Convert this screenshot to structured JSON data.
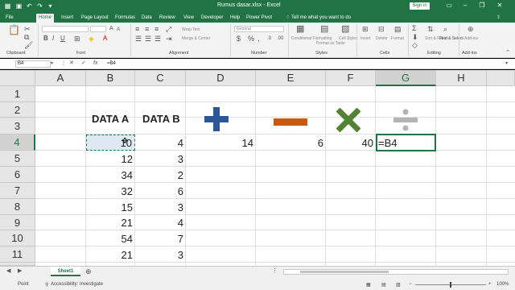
{
  "window": {
    "title": "Rumus dasar.xlsx  -  Excel",
    "signin": "Sign in"
  },
  "tabs": [
    "File",
    "Home",
    "Insert",
    "Page Layout",
    "Formulas",
    "Data",
    "Review",
    "View",
    "Developer",
    "Help",
    "Power Pivot"
  ],
  "tell_me": "Tell me what you want to do",
  "ribbon": {
    "groups": [
      "Clipboard",
      "Font",
      "Alignment",
      "Number",
      "Styles",
      "Cells",
      "Editing",
      "Add-ins"
    ],
    "wrap_text": "Wrap Text",
    "merge_center": "Merge & Center",
    "number_format": "General",
    "styles_buttons": [
      "Conditional Formatting",
      "Format as Table",
      "Cell Styles"
    ],
    "cells_buttons": [
      "Insert",
      "Delete",
      "Format"
    ],
    "editing_buttons": [
      "Sort & Filter",
      "Find & Select"
    ],
    "addins_button": "Add-ins"
  },
  "formula_bar": {
    "name_box": "B4",
    "formula": "=B4"
  },
  "grid": {
    "columns": [
      "A",
      "B",
      "C",
      "D",
      "E",
      "F",
      "G",
      "H"
    ],
    "rows": [
      "1",
      "2",
      "3",
      "4",
      "5",
      "6",
      "7",
      "8",
      "9",
      "10",
      "11"
    ],
    "selected_col": "G",
    "selected_row": "4",
    "header_a": "DATA A",
    "header_b": "DATA B",
    "row4": {
      "B": "10",
      "C": "4",
      "D": "14",
      "E": "6",
      "F": "40",
      "G": "=B4"
    },
    "data_a": [
      "12",
      "34",
      "32",
      "15",
      "21",
      "54",
      "21"
    ],
    "data_b": [
      "3",
      "2",
      "6",
      "3",
      "4",
      "7",
      "3"
    ]
  },
  "operators": [
    {
      "name": "plus",
      "color": "#2b579a"
    },
    {
      "name": "minus",
      "color": "#c55a11"
    },
    {
      "name": "multiply",
      "color": "#548235"
    },
    {
      "name": "divide",
      "color": "#b4b4b4"
    }
  ],
  "sheet_tab": "Sheet1",
  "status": {
    "mode": "Point",
    "accessibility": "Accessibility: Investigate",
    "zoom": "100%"
  }
}
